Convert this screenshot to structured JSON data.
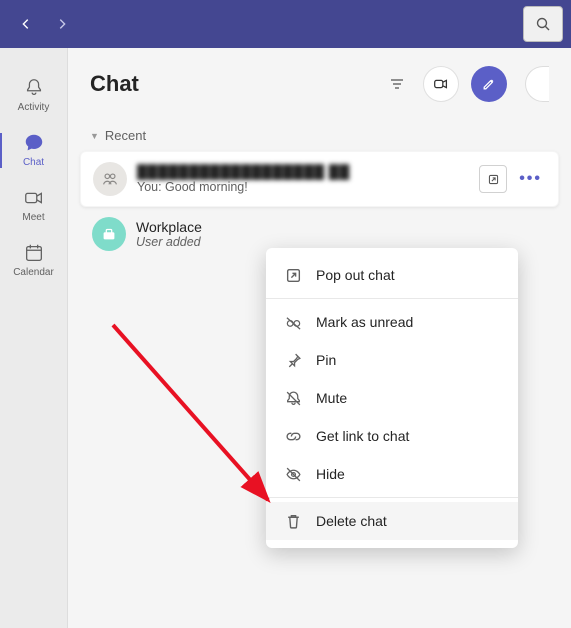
{
  "titlebar": {
    "back_tooltip": "Back",
    "forward_tooltip": "Forward",
    "search_tooltip": "Search"
  },
  "rail": {
    "items": [
      {
        "id": "activity",
        "label": "Activity"
      },
      {
        "id": "chat",
        "label": "Chat"
      },
      {
        "id": "meet",
        "label": "Meet"
      },
      {
        "id": "calendar",
        "label": "Calendar"
      }
    ]
  },
  "chat_panel": {
    "title": "Chat",
    "section_label": "Recent",
    "filter_tooltip": "Filter",
    "video_tooltip": "Meet now",
    "compose_tooltip": "New chat"
  },
  "chats": [
    {
      "name": "██████████████████ ██",
      "preview": "You: Good morning!",
      "avatar": "group",
      "selected": true,
      "popout_tooltip": "Pop out chat",
      "more_tooltip": "More options"
    },
    {
      "name": "Workplace",
      "preview": "User added",
      "avatar": "teal"
    }
  ],
  "context_menu": {
    "items": [
      {
        "id": "popout",
        "label": "Pop out chat"
      },
      {
        "sep": true
      },
      {
        "id": "unread",
        "label": "Mark as unread"
      },
      {
        "id": "pin",
        "label": "Pin"
      },
      {
        "id": "mute",
        "label": "Mute"
      },
      {
        "id": "link",
        "label": "Get link to chat"
      },
      {
        "id": "hide",
        "label": "Hide"
      },
      {
        "sep": true
      },
      {
        "id": "delete",
        "label": "Delete chat",
        "hovered": true
      }
    ]
  }
}
